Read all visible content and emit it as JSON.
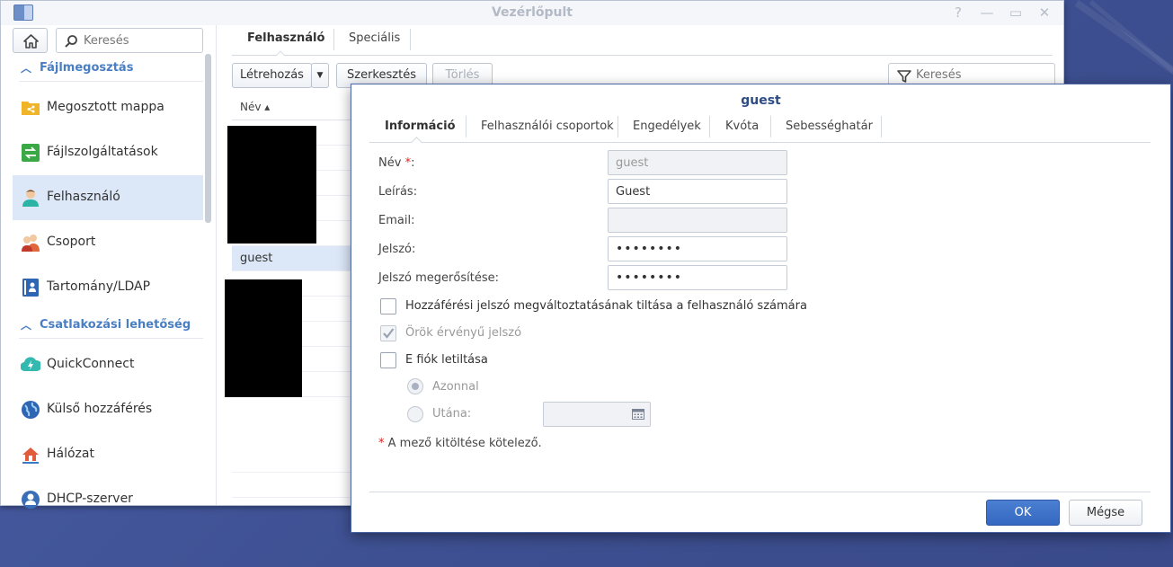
{
  "window": {
    "title": "Vezérlőpult",
    "controls": [
      "?",
      "—",
      "▭",
      "✕"
    ]
  },
  "sidebar": {
    "search_placeholder": "Keresés",
    "sections": [
      {
        "title": "Fájlmegosztás",
        "items": [
          {
            "label": "Megosztott mappa",
            "icon": "shared-folder-icon"
          },
          {
            "label": "Fájlszolgáltatások",
            "icon": "file-services-icon"
          },
          {
            "label": "Felhasználó",
            "icon": "user-icon",
            "active": true
          },
          {
            "label": "Csoport",
            "icon": "group-icon"
          },
          {
            "label": "Tartomány/LDAP",
            "icon": "domain-ldap-icon"
          }
        ]
      },
      {
        "title": "Csatlakozási lehetőség",
        "items": [
          {
            "label": "QuickConnect",
            "icon": "quickconnect-icon"
          },
          {
            "label": "Külső hozzáférés",
            "icon": "external-access-icon"
          },
          {
            "label": "Hálózat",
            "icon": "network-icon"
          },
          {
            "label": "DHCP-szerver",
            "icon": "dhcp-server-icon"
          }
        ]
      }
    ]
  },
  "main": {
    "tabs": [
      "Felhasználó",
      "Speciális"
    ],
    "toolbar": {
      "create": "Létrehozás",
      "edit": "Szerkesztés",
      "delete": "Törlés",
      "filter_placeholder": "Keresés"
    },
    "grid": {
      "column": "Név ▴",
      "selected_row": "guest"
    }
  },
  "dialog": {
    "title": "guest",
    "tabs": [
      "Információ",
      "Felhasználói csoportok",
      "Engedélyek",
      "Kvóta",
      "Sebességhatár"
    ],
    "fields": {
      "name_label": "Név ",
      "name_required": "*",
      "name_suffix": ":",
      "name_value": "guest",
      "description_label": "Leírás:",
      "description_value": "Guest",
      "email_label": "Email:",
      "email_value": "",
      "password_label": "Jelszó:",
      "password_value": "••••••••",
      "confirm_label": "Jelszó megerősítése:",
      "confirm_value": "••••••••"
    },
    "options": {
      "disallow_password_change": "Hozzáférési jelszó megváltoztatásának tiltása a felhasználó számára",
      "password_never_expires": "Örök érvényű jelszó",
      "disable_account": "E fiók letiltása",
      "immediately": "Azonnal",
      "after": "Utána:"
    },
    "required_note_star": "*",
    "required_note": " A mező kitöltése kötelező.",
    "buttons": {
      "ok": "OK",
      "cancel": "Mégse"
    }
  }
}
